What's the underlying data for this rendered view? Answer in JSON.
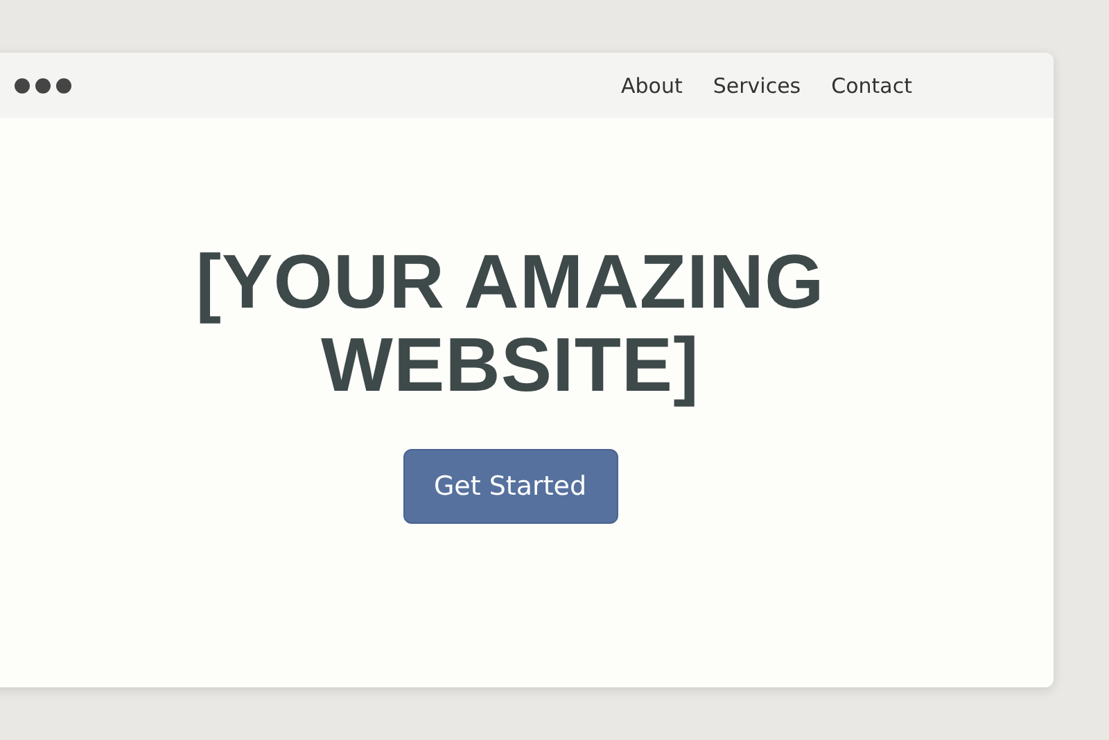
{
  "nav": {
    "items": [
      {
        "label": "About"
      },
      {
        "label": "Services"
      },
      {
        "label": "Contact"
      }
    ]
  },
  "hero": {
    "title": "[YOUR AMAZING WEBSITE]",
    "button": "Get Started"
  }
}
